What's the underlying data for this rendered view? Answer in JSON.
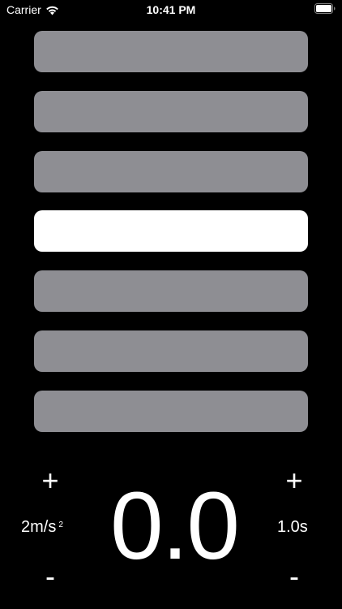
{
  "status_bar": {
    "carrier": "Carrier",
    "time": "10:41 PM"
  },
  "levels": {
    "count": 7,
    "active_index": 3,
    "inactive_color": "#8e8e93",
    "active_color": "#ffffff"
  },
  "controls": {
    "acceleration": {
      "value": "2m/s",
      "exponent": "2",
      "plus_label": "+",
      "minus_label": "-"
    },
    "readout": "0.0",
    "duration": {
      "value": "1.0s",
      "plus_label": "+",
      "minus_label": "-"
    }
  }
}
